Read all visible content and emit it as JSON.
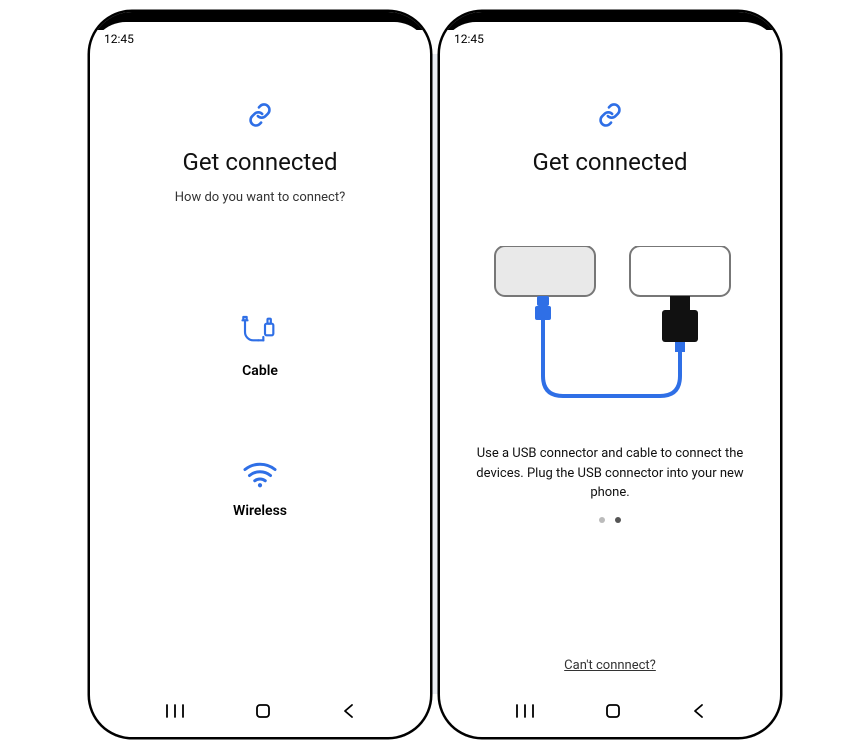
{
  "accent": "#2f6fe6",
  "status_time": "12:45",
  "left": {
    "title": "Get connected",
    "subtitle": "How do you want to connect?",
    "options": {
      "cable": "Cable",
      "wireless": "Wireless"
    }
  },
  "right": {
    "title": "Get connected",
    "instruction": "Use a USB connector and cable to connect the devices. Plug the USB connector into your new phone.",
    "help_link": "Can't connnect?",
    "page_dots": {
      "total": 2,
      "active": 2
    }
  }
}
